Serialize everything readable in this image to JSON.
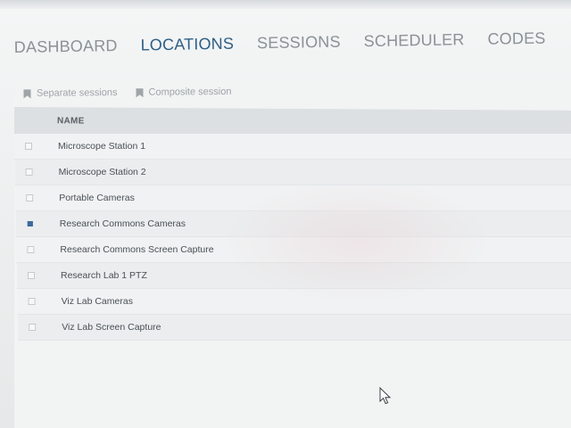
{
  "nav": {
    "tabs": [
      {
        "label": "DASHBOARD",
        "active": false
      },
      {
        "label": "LOCATIONS",
        "active": true
      },
      {
        "label": "SESSIONS",
        "active": false
      },
      {
        "label": "SCHEDULER",
        "active": false
      },
      {
        "label": "CODES",
        "active": false
      }
    ]
  },
  "toolbar": {
    "separate_sessions_label": "Separate sessions",
    "composite_session_label": "Composite session",
    "icon": "bookmark-icon"
  },
  "table": {
    "header_name": "NAME",
    "rows": [
      {
        "name": "Microscope Station 1",
        "checked": false
      },
      {
        "name": "Microscope Station 2",
        "checked": false
      },
      {
        "name": "Portable Cameras",
        "checked": false
      },
      {
        "name": "Research Commons Cameras",
        "checked": true
      },
      {
        "name": "Research Commons Screen Capture",
        "checked": false
      },
      {
        "name": "Research Lab 1 PTZ",
        "checked": false
      },
      {
        "name": "Viz Lab Cameras",
        "checked": false
      },
      {
        "name": "Viz Lab Screen Capture",
        "checked": false
      }
    ]
  },
  "colors": {
    "active_tab": "#2f5f86",
    "inactive_tab": "#8b9195",
    "checked_box": "#3d6a9c",
    "header_bg": "#dde0e2"
  }
}
